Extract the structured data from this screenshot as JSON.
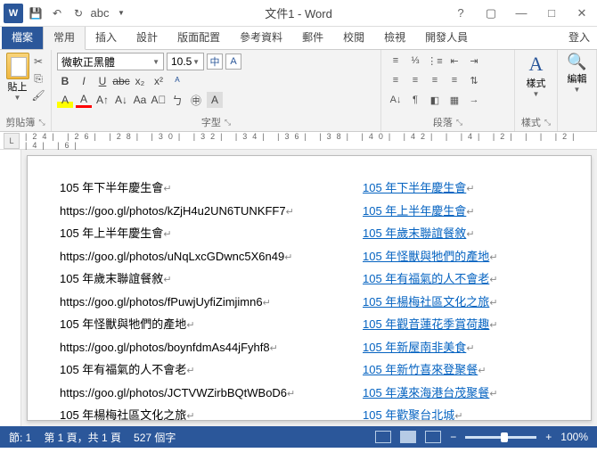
{
  "title": "文件1 - Word",
  "login": "登入",
  "tabs": {
    "file": "檔案",
    "home": "常用",
    "insert": "插入",
    "design": "設計",
    "layout": "版面配置",
    "ref": "參考資料",
    "mail": "郵件",
    "review": "校閱",
    "view": "檢視",
    "dev": "開發人員"
  },
  "groups": {
    "clipboard": "剪貼簿",
    "font": "字型",
    "paragraph": "段落",
    "styles": "樣式",
    "editing": "編輯"
  },
  "paste_label": "貼上",
  "font_name": "微軟正黑體",
  "font_size": "10.5",
  "zhong": "中",
  "style_label": "樣式",
  "edit_label": "編輯",
  "ruler_marks": [
    "24",
    "1",
    "26",
    "1",
    "28",
    "1",
    "30",
    "1",
    "32",
    "1",
    "34",
    "1",
    "36",
    "1",
    "38",
    "1",
    "40",
    "1",
    "42",
    "1",
    "4",
    "1",
    "2",
    "1",
    "",
    "1",
    "2",
    "1",
    "4",
    "1",
    "6"
  ],
  "left_lines": [
    "105 年下半年慶生會",
    "https://goo.gl/photos/kZjH4u2UN6TUNKFF7",
    "105 年上半年慶生會",
    "https://goo.gl/photos/uNqLxcGDwnc5X6n49",
    "105 年歲末聯誼餐敘",
    "https://goo.gl/photos/fPuwjUyfiZimjimn6",
    "105 年怪獸與牠們的產地",
    "https://goo.gl/photos/boynfdmAs44jFyhf8",
    "105 年有福氣的人不會老",
    "https://goo.gl/photos/JCTVWZirbBQtWBoD6",
    "105 年楊梅社區文化之旅"
  ],
  "right_links": [
    "105 年下半年慶生會",
    "105 年上半年慶生會",
    "105 年歲末聯誼餐敘",
    "105 年怪獸與牠們的產地",
    "105 年有福氣的人不會老",
    "105 年楊梅社區文化之旅",
    "105 年觀音蓮花季賞荷趣",
    "105 年新屋南非美食",
    "105 年新竹喜來登聚餐",
    "105 年漢來海港台茂聚餐",
    "105 年歡聚台北城"
  ],
  "status": {
    "section": "節: 1",
    "page": "第 1 頁，共 1 頁",
    "words": "527 個字",
    "zoom": "100%"
  }
}
